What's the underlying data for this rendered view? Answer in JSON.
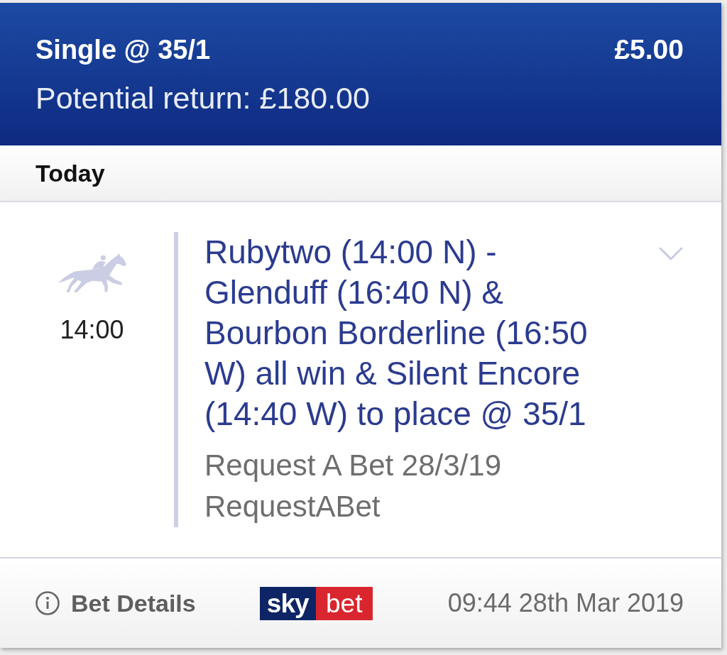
{
  "bet": {
    "title": "Single @ 35/1",
    "stake": "£5.00",
    "potential_return": "Potential return: £180.00"
  },
  "group": {
    "heading": "Today"
  },
  "selection": {
    "time": "14:00",
    "description": "Rubytwo (14:00 N) - Glenduff (16:40 N) & Bourbon Borderline (16:50 W) all win & Silent Encore (14:40 W) to place @ 35/1",
    "market": "Request A Bet 28/3/19",
    "event": "RequestABet",
    "expanded": false
  },
  "footer": {
    "details_link": "Bet Details",
    "logo": {
      "left": "sky",
      "right": "bet"
    },
    "placed_at": "09:44 28th Mar 2019"
  }
}
